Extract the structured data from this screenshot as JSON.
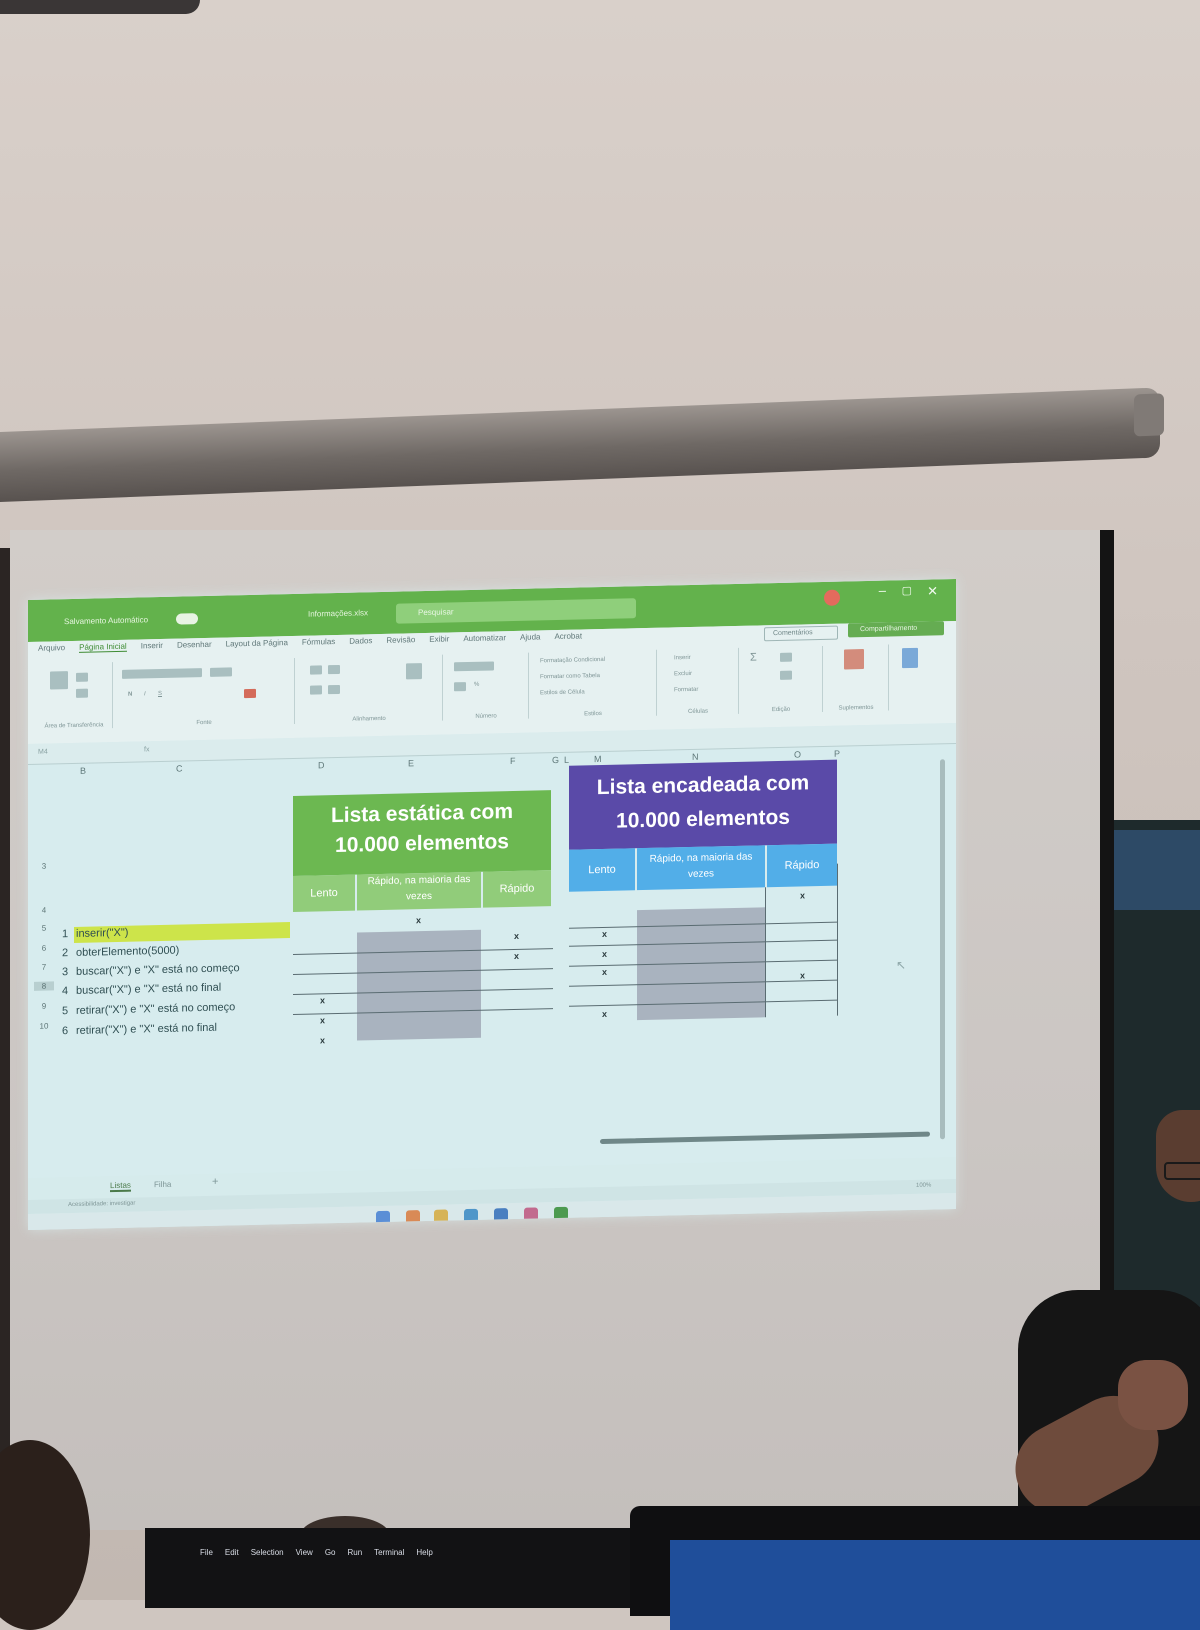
{
  "titlebar": {
    "autosave": "Salvamento Automático",
    "filename": "Informações.xlsx",
    "search_placeholder": "Pesquisar",
    "share": "Compartilhamento",
    "comments": "Comentários"
  },
  "ribbon": {
    "tabs": [
      "Arquivo",
      "Página Inicial",
      "Inserir",
      "Desenhar",
      "Layout da Página",
      "Fórmulas",
      "Dados",
      "Revisão",
      "Exibir",
      "Automatizar",
      "Ajuda",
      "Acrobat"
    ],
    "groups": [
      "Área de Transferência",
      "Fonte",
      "Alinhamento",
      "Número",
      "Estilos",
      "Células",
      "Edição",
      "Suplementos"
    ],
    "styles_items": [
      "Formatação Condicional",
      "Formatar como Tabela",
      "Estilos de Célula"
    ],
    "cells_items": [
      "Inserir",
      "Excluir",
      "Formatar"
    ]
  },
  "columns": [
    "B",
    "C",
    "D",
    "E",
    "F",
    "G",
    "L",
    "M",
    "N",
    "O",
    "P"
  ],
  "row_numbers": [
    "3",
    "4",
    "5",
    "6",
    "7",
    "8",
    "9",
    "10"
  ],
  "static_header": {
    "title_line1": "Lista estática com",
    "title_line2": "10.000 elementos",
    "col_slow": "Lento",
    "col_mostly": "Rápido, na maioria das vezes",
    "col_fast": "Rápido"
  },
  "linked_header": {
    "title_line1": "Lista encadeada com",
    "title_line2": "10.000 elementos",
    "col_slow": "Lento",
    "col_mostly": "Rápido, na maioria das vezes",
    "col_fast": "Rápido"
  },
  "operations": [
    {
      "n": "1",
      "label": "inserir(\"X\")"
    },
    {
      "n": "2",
      "label": "obterElemento(5000)"
    },
    {
      "n": "3",
      "label": "buscar(\"X\") e \"X\" está no começo"
    },
    {
      "n": "4",
      "label": "buscar(\"X\") e \"X\" está no final"
    },
    {
      "n": "5",
      "label": "retirar(\"X\") e \"X\" está no começo"
    },
    {
      "n": "6",
      "label": "retirar(\"X\") e \"X\" está no final"
    }
  ],
  "mark": "x",
  "sheet_tabs": [
    "Listas",
    "Filha"
  ],
  "status": {
    "accessibility": "Acessibilidade: investigar",
    "zoom": "100%"
  },
  "menu_bar_laptop": [
    "File",
    "Edit",
    "Selection",
    "View",
    "Go",
    "Run",
    "Terminal",
    "Help"
  ]
}
